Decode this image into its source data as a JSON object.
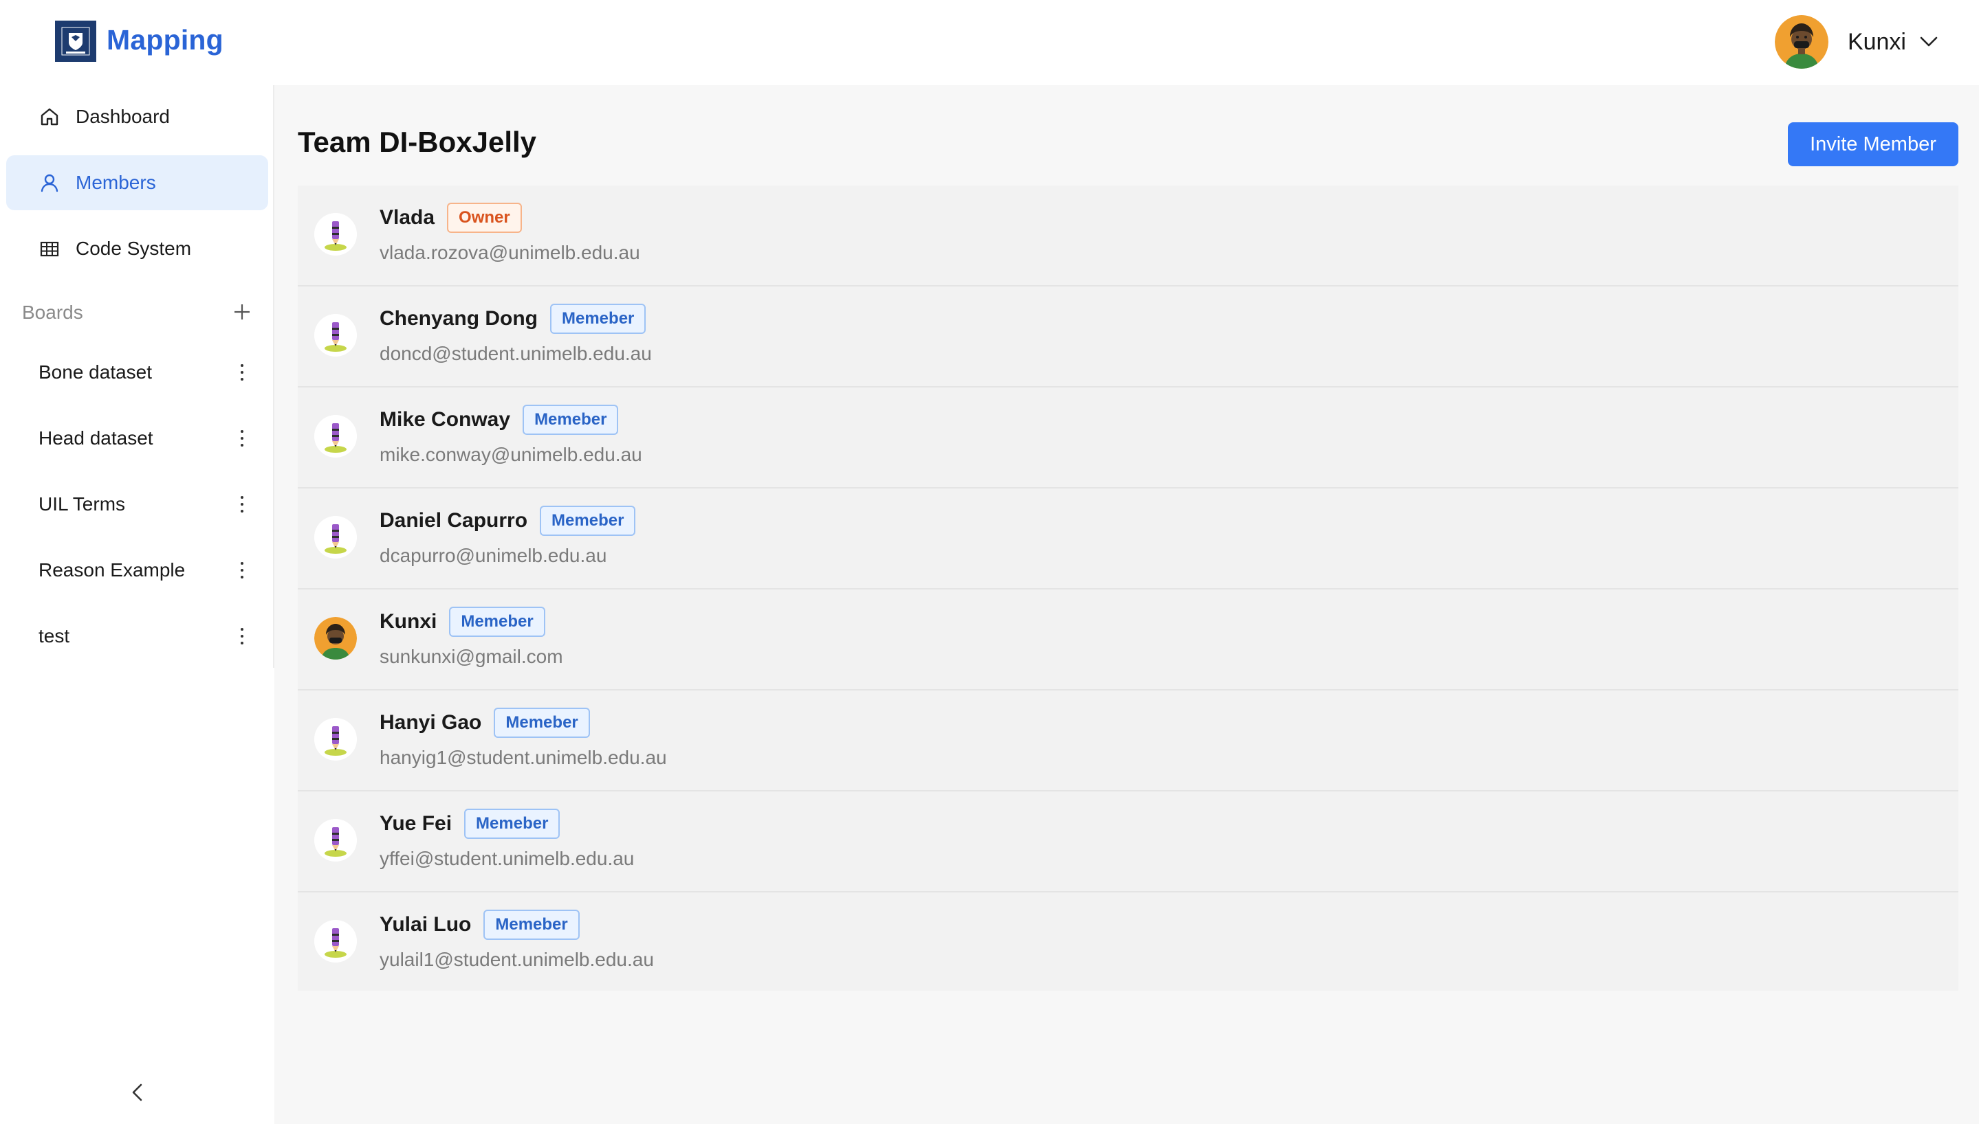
{
  "app": {
    "title": "Mapping"
  },
  "user": {
    "name": "Kunxi"
  },
  "sidebar": {
    "nav": [
      {
        "label": "Dashboard",
        "icon": "home-icon"
      },
      {
        "label": "Members",
        "icon": "user-icon",
        "active": true
      },
      {
        "label": "Code System",
        "icon": "table-icon"
      }
    ],
    "boards_label": "Boards",
    "boards": [
      {
        "label": "Bone dataset"
      },
      {
        "label": "Head dataset"
      },
      {
        "label": "UIL Terms"
      },
      {
        "label": "Reason Example"
      },
      {
        "label": "test"
      }
    ]
  },
  "main": {
    "title": "Team DI-BoxJelly",
    "invite_label": "Invite Member",
    "members": [
      {
        "name": "Vlada",
        "role": "Owner",
        "email": "vlada.rozova@unimelb.edu.au",
        "avatar": "pencil"
      },
      {
        "name": "Chenyang Dong",
        "role": "Memeber",
        "email": "doncd@student.unimelb.edu.au",
        "avatar": "pencil"
      },
      {
        "name": "Mike Conway",
        "role": "Memeber",
        "email": "mike.conway@unimelb.edu.au",
        "avatar": "pencil"
      },
      {
        "name": "Daniel Capurro",
        "role": "Memeber",
        "email": "dcapurro@unimelb.edu.au",
        "avatar": "pencil"
      },
      {
        "name": "Kunxi",
        "role": "Memeber",
        "email": "sunkunxi@gmail.com",
        "avatar": "person"
      },
      {
        "name": "Hanyi Gao",
        "role": "Memeber",
        "email": "hanyig1@student.unimelb.edu.au",
        "avatar": "pencil"
      },
      {
        "name": "Yue Fei",
        "role": "Memeber",
        "email": "yffei@student.unimelb.edu.au",
        "avatar": "pencil"
      },
      {
        "name": "Yulai Luo",
        "role": "Memeber",
        "email": "yulail1@student.unimelb.edu.au",
        "avatar": "pencil"
      }
    ]
  },
  "colors": {
    "brand": "#2a64d6",
    "invite_button": "#3478f6",
    "active_nav_bg": "#e6f0fd",
    "owner_badge": "#d9531e",
    "member_badge": "#2a64c6"
  }
}
